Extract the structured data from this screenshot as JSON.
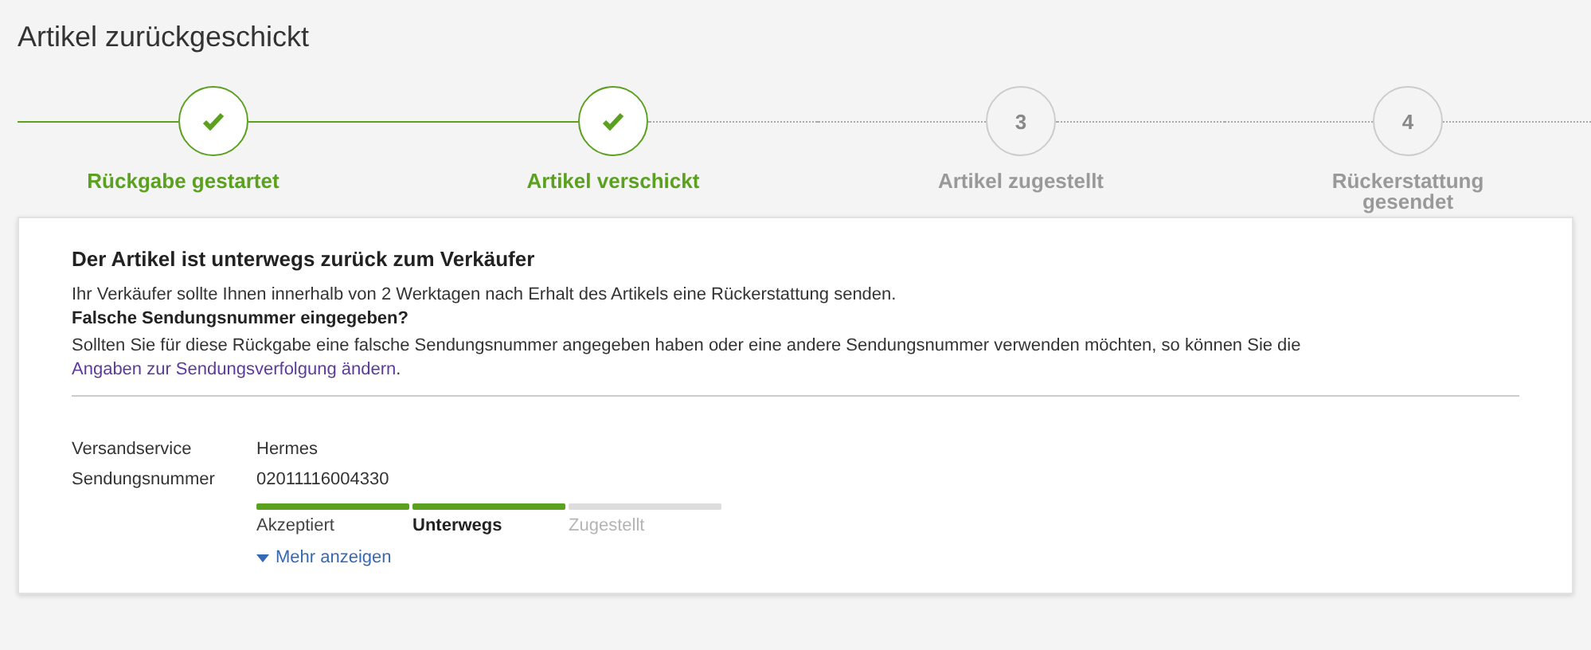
{
  "page_title": "Artikel zurückgeschickt",
  "steps": [
    {
      "label": "Rückgabe gestartet",
      "done": true
    },
    {
      "label": "Artikel verschickt",
      "done": true
    },
    {
      "number": "3",
      "label": "Artikel zugestellt",
      "done": false
    },
    {
      "number": "4",
      "label": "Rückerstattung gesendet",
      "done": false
    }
  ],
  "card": {
    "heading": "Der Artikel ist unterwegs zurück zum Verkäufer",
    "info": "Ihr Verkäufer sollte Ihnen innerhalb von 2 Werktagen nach Erhalt des Artikels eine Rückerstattung senden.",
    "question": "Falsche Sendungsnummer eingegeben?",
    "explanation": "Sollten Sie für diese Rückgabe eine falsche Sendungsnummer angegeben haben oder eine andere Sendungsnummer verwenden möchten, so können Sie die",
    "link": "Angaben zur Sendungsverfolgung ändern",
    "link_end": ".",
    "details": [
      {
        "label": "Versandservice",
        "value": "Hermes"
      },
      {
        "label": "Sendungsnummer",
        "value": "02011116004330"
      }
    ],
    "tracking": [
      {
        "label": "Akzeptiert",
        "reached": true,
        "selected": false
      },
      {
        "label": "Unterwegs",
        "reached": true,
        "selected": true
      },
      {
        "label": "Zugestellt",
        "reached": false,
        "selected": false
      }
    ],
    "more_link": "Mehr anzeigen"
  }
}
